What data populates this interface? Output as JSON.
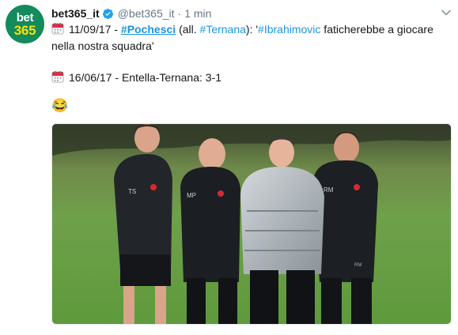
{
  "tweet": {
    "avatar": {
      "line1": "bet",
      "line2": "365"
    },
    "display_name": "bet365_it",
    "handle": "@bet365_it",
    "separator": "·",
    "time": "1 min",
    "line1": {
      "date": "11/09/17",
      "dash": " - ",
      "hashtag_pochesci": "#Pochesci",
      "all_open": " (all. ",
      "hashtag_ternana": "#Ternana",
      "all_close": "): '",
      "hashtag_ibrahimovic": "#Ibrahimovic",
      "quote_rest": " faticherebbe a giocare"
    },
    "line2": "nella nostra squadra'",
    "line3": {
      "date": "16/06/17",
      "rest": " - Entella-Ternana: 3-1"
    },
    "emoji": "😂",
    "photo": {
      "initials": [
        "TS",
        "MP",
        "RM"
      ],
      "initials_small": "RM"
    }
  },
  "colors": {
    "link": "#1b95e0",
    "verified": "#1da1f2",
    "brand_green": "#138b5c",
    "brand_yellow": "#ffe000"
  }
}
